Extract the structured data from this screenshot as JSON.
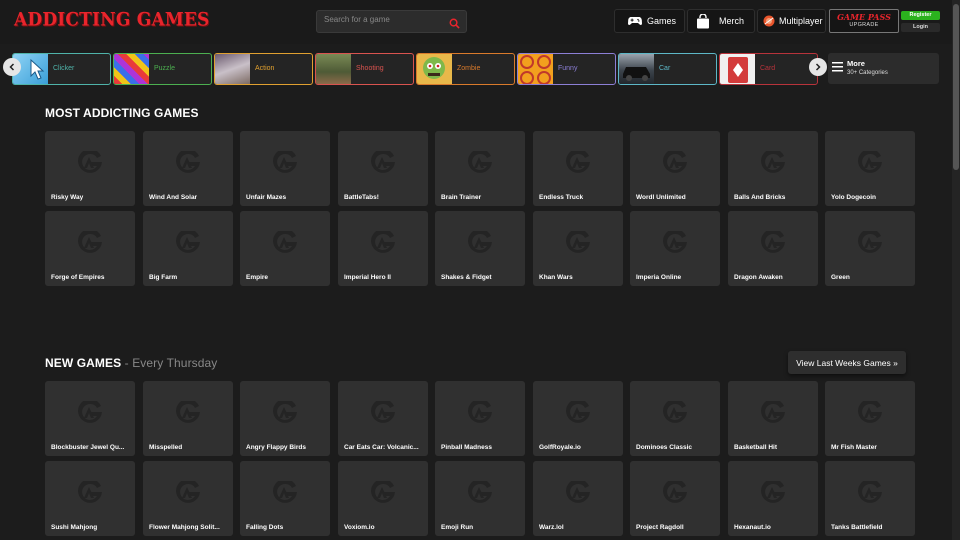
{
  "header": {
    "logo_text": "ADDICTING GAMES",
    "search_placeholder": "Search for a game",
    "nav": {
      "games": "Games",
      "merch": "Merch",
      "multiplayer": "Multiplayer"
    },
    "gamepass": {
      "title": "GAME PASS",
      "subtitle": "UPGRADE"
    },
    "register": "Register",
    "login": "Login"
  },
  "categories": [
    {
      "label": "Clicker",
      "color": "#4fb3a9"
    },
    {
      "label": "Puzzle",
      "color": "#4caf50"
    },
    {
      "label": "Action",
      "color": "#e0a030"
    },
    {
      "label": "Shooting",
      "color": "#d9534f"
    },
    {
      "label": "Zombie",
      "color": "#d97a2b"
    },
    {
      "label": "Funny",
      "color": "#8c7fd6"
    },
    {
      "label": "Car",
      "color": "#5db7c7"
    },
    {
      "label": "Card",
      "color": "#b8333b"
    }
  ],
  "more_categories": {
    "label": "More",
    "sub": "30+ Categories"
  },
  "most_addicting": {
    "title": "MOST ADDICTING GAMES",
    "games": [
      "Risky Way",
      "Wind And Solar",
      "Unfair Mazes",
      "BattleTabs!",
      "Brain Trainer",
      "Endless Truck",
      "Wordl Unlimited",
      "Balls And Bricks",
      "Yolo Dogecoin",
      "Forge of Empires",
      "Big Farm",
      "Empire",
      "Imperial Hero II",
      "Shakes & Fidget",
      "Khan Wars",
      "Imperia Online",
      "Dragon Awaken",
      "Green"
    ]
  },
  "new_games": {
    "title": "NEW GAMES",
    "subtitle": " - Every Thursday",
    "view_last": "View Last Weeks Games »",
    "games": [
      "Blockbuster Jewel Qu...",
      "Misspelled",
      "Angry Flappy Birds",
      "Car Eats Car: Volcanic...",
      "Pinball Madness",
      "GolfRoyale.io",
      "Dominoes Classic",
      "Basketball Hit",
      "Mr Fish Master",
      "Sushi Mahjong",
      "Flower Mahjong Solit...",
      "Falling Dots",
      "Voxiom.io",
      "Emoji Run",
      "Warz.lol",
      "Project Ragdoll",
      "Hexanaut.io",
      "Tanks Battlefield"
    ]
  }
}
